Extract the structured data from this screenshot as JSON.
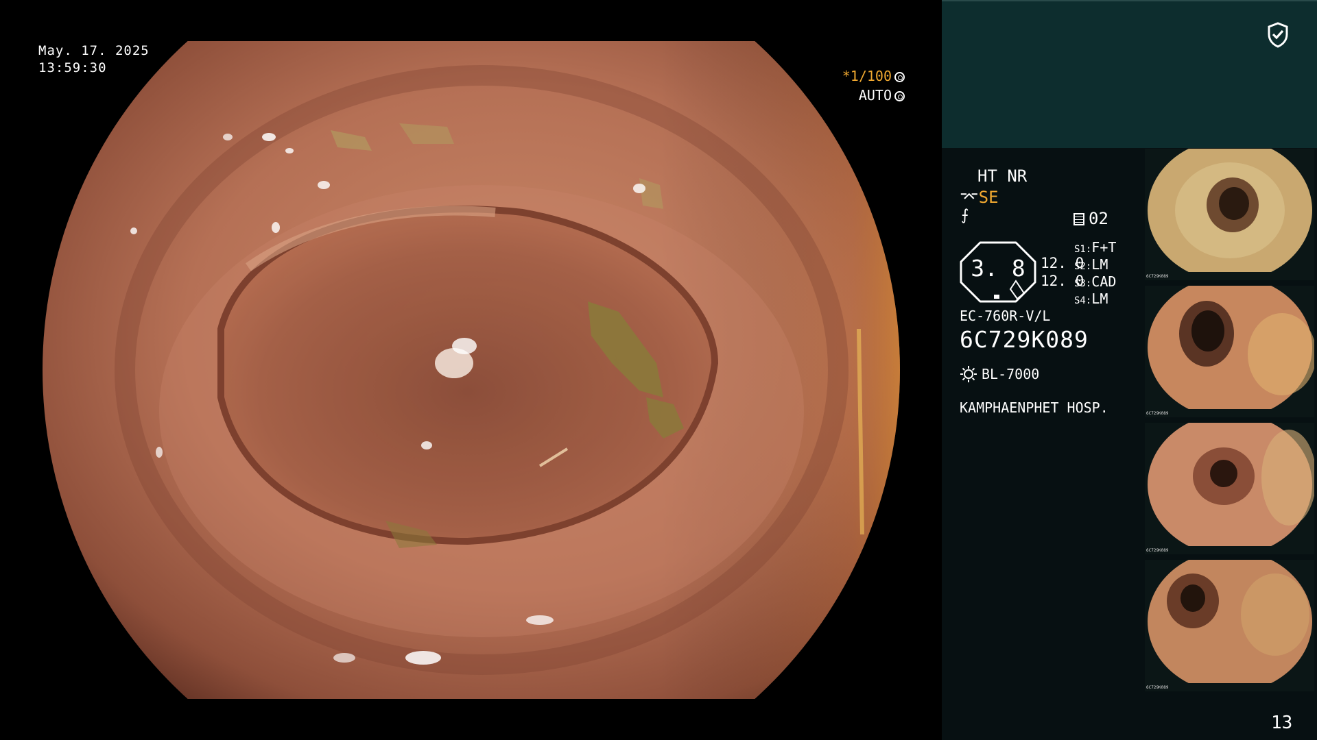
{
  "overlay": {
    "date": "May. 17. 2025",
    "time": "13:59:30",
    "shutter": "*1/100",
    "iris": "AUTO"
  },
  "panel": {
    "modes": "HT NR",
    "se_label": "SE",
    "f_symbol": "⨍",
    "memory": "02",
    "gauge_value": "3. 8",
    "gain_1": "12. 0",
    "gain_2": "12. 0",
    "switches": [
      {
        "label": "S1",
        "value": "F+T"
      },
      {
        "label": "S2",
        "value": "LM"
      },
      {
        "label": "S3",
        "value": "CAD"
      },
      {
        "label": "S4",
        "value": "LM"
      }
    ],
    "scope_model": "EC-760R-V/L",
    "serial": "6C729K089",
    "light_source": "BL-7000",
    "hospital": "KAMPHAENPHET HOSP.",
    "page_number": "13"
  },
  "thumbnails": [
    {
      "caption": "6C729K089"
    },
    {
      "caption": "6C729K089"
    },
    {
      "caption": "6C729K089"
    },
    {
      "caption": "6C729K089"
    }
  ],
  "colors": {
    "accent_orange": "#f0a830",
    "panel_bg": "#071012",
    "panel_top_bg": "#0d2d2e"
  },
  "icons": [
    "shield-check-icon",
    "iris-icon",
    "memory-doc-icon",
    "lamp-icon",
    "shutter-icon"
  ]
}
